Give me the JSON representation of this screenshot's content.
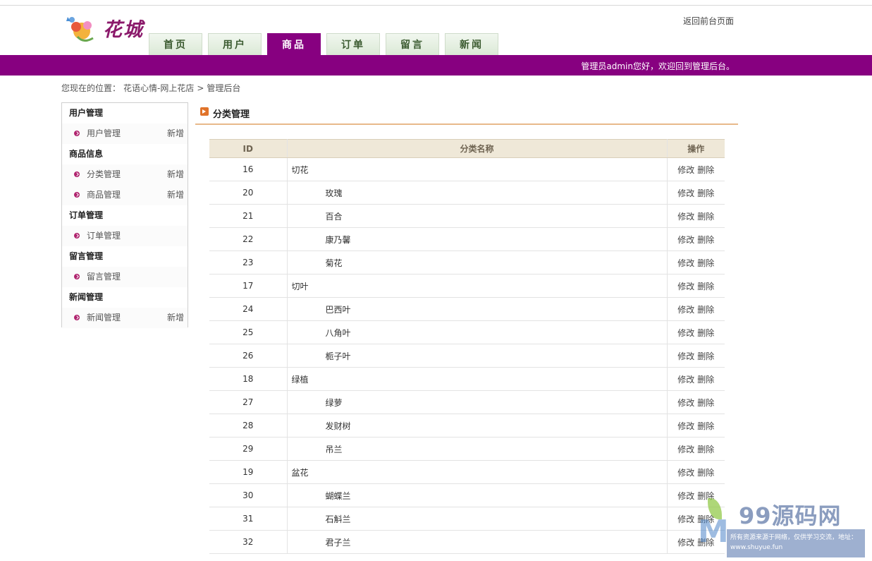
{
  "header": {
    "logo_text": "花城",
    "return_link": "返回前台页面",
    "welcome": "管理员admin您好，欢迎回到管理后台。"
  },
  "nav": {
    "tabs": [
      {
        "label": "首页"
      },
      {
        "label": "用户"
      },
      {
        "label": "商品"
      },
      {
        "label": "订单"
      },
      {
        "label": "留言"
      },
      {
        "label": "新闻"
      }
    ],
    "active_index": 2
  },
  "breadcrumb": {
    "prefix": "您现在的位置：",
    "site": "花语心情-网上花店",
    "separator": ">",
    "current": "管理后台"
  },
  "sidebar": {
    "groups": [
      {
        "title": "用户管理",
        "items": [
          {
            "label": "用户管理",
            "add": "新增"
          }
        ]
      },
      {
        "title": "商品信息",
        "items": [
          {
            "label": "分类管理",
            "add": "新增"
          },
          {
            "label": "商品管理",
            "add": "新增"
          }
        ]
      },
      {
        "title": "订单管理",
        "items": [
          {
            "label": "订单管理",
            "add": ""
          }
        ]
      },
      {
        "title": "留言管理",
        "items": [
          {
            "label": "留言管理",
            "add": ""
          }
        ]
      },
      {
        "title": "新闻管理",
        "items": [
          {
            "label": "新闻管理",
            "add": "新增"
          }
        ]
      }
    ]
  },
  "section": {
    "title": "分类管理"
  },
  "table": {
    "headers": {
      "id": "ID",
      "name": "分类名称",
      "ops": "操作"
    },
    "edit_label": "修改",
    "delete_label": "删除",
    "rows": [
      {
        "id": "16",
        "name": "切花",
        "sub": false
      },
      {
        "id": "20",
        "name": "玫瑰",
        "sub": true
      },
      {
        "id": "21",
        "name": "百合",
        "sub": true
      },
      {
        "id": "22",
        "name": "康乃馨",
        "sub": true
      },
      {
        "id": "23",
        "name": "菊花",
        "sub": true
      },
      {
        "id": "17",
        "name": "切叶",
        "sub": false
      },
      {
        "id": "24",
        "name": "巴西叶",
        "sub": true
      },
      {
        "id": "25",
        "name": "八角叶",
        "sub": true
      },
      {
        "id": "26",
        "name": "栀子叶",
        "sub": true
      },
      {
        "id": "18",
        "name": "绿植",
        "sub": false
      },
      {
        "id": "27",
        "name": "绿萝",
        "sub": true
      },
      {
        "id": "28",
        "name": "发财树",
        "sub": true
      },
      {
        "id": "29",
        "name": "吊兰",
        "sub": true
      },
      {
        "id": "19",
        "name": "盆花",
        "sub": false
      },
      {
        "id": "30",
        "name": "蝴蝶兰",
        "sub": true
      },
      {
        "id": "31",
        "name": "石斛兰",
        "sub": true
      },
      {
        "id": "32",
        "name": "君子兰",
        "sub": true
      }
    ]
  },
  "watermark": {
    "brand": "99源码网",
    "note": "所有资源来源于网络，仅供学习交流，地址：www.shuyue.fun"
  }
}
